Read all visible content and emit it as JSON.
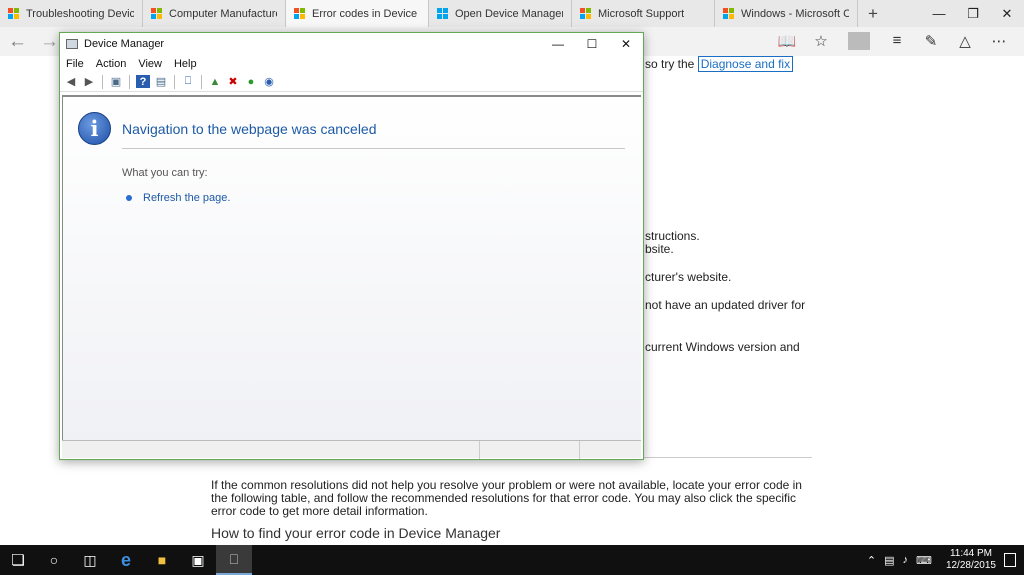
{
  "browser": {
    "tabs": [
      {
        "title": "Troubleshooting Device Cc",
        "active": false
      },
      {
        "title": "Computer Manufacturers' (",
        "active": false
      },
      {
        "title": "Error codes in Device M",
        "active": true
      },
      {
        "title": "Open Device Manager - W",
        "active": false
      },
      {
        "title": "Microsoft Support",
        "active": false
      },
      {
        "title": "Windows - Microsoft Comr",
        "active": false
      }
    ],
    "new_tab": "+",
    "tab_icon_colors": [
      "#f25022",
      "#7fba00",
      "#00a4ef",
      "#ffb900"
    ]
  },
  "webpage": {
    "fragment_1_prefix": "so try the",
    "fragment_1_link": "Diagnose and fix",
    "fragment_2": "structions.",
    "fragment_3": "bsite.",
    "fragment_4": "cturer's website.",
    "fragment_5": "not have an updated driver for",
    "fragment_6": "current Windows version and",
    "paragraph": "If the common resolutions did not help you resolve your problem or were not available, locate your error code in the following table, and follow the recommended resolutions for that error code. You may also click the specific error code to get more detail information.",
    "heading": "How to find your error code in Device Manager"
  },
  "device_manager": {
    "title": "Device Manager",
    "menu": [
      "File",
      "Action",
      "View",
      "Help"
    ],
    "message_title": "Navigation to the webpage was canceled",
    "what_you_can_try": "What you can try:",
    "refresh_link": "Refresh the page."
  },
  "taskbar": {
    "time": "11:44 PM",
    "date": "12/28/2015"
  }
}
